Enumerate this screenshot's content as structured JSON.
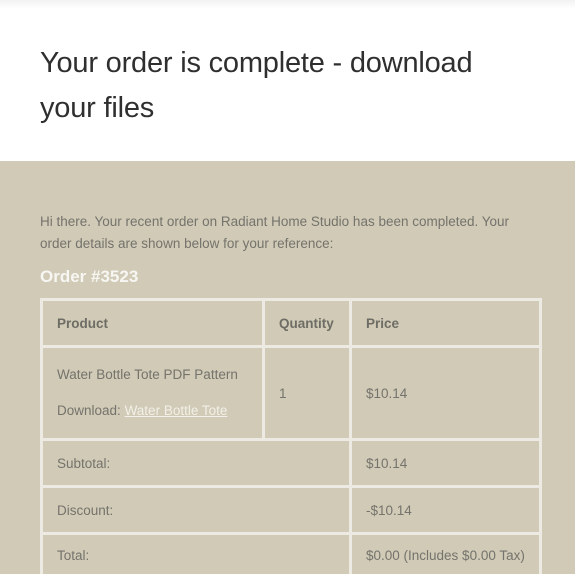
{
  "page": {
    "title": "Your order is complete - download your files",
    "intro": "Hi there. Your recent order on Radiant Home Studio has been completed. Your order details are shown below for your reference:",
    "order_heading": "Order #3523"
  },
  "colors": {
    "page_background": "#ffffff",
    "content_background": "#d0cab6",
    "table_border": "#eceae2",
    "body_text": "#74736c",
    "heading_text": "#2f2f2f",
    "order_heading_text": "#f7f6f2",
    "link_text": "#f2f0e8"
  },
  "table": {
    "headers": {
      "product": "Product",
      "quantity": "Quantity",
      "price": "Price"
    },
    "items": [
      {
        "name": "Water Bottle Tote PDF Pattern",
        "download_label": "Download:",
        "download_link_text": "Water Bottle Tote",
        "quantity": "1",
        "price": "$10.14"
      }
    ],
    "summary": [
      {
        "label": "Subtotal:",
        "value": "$10.14"
      },
      {
        "label": "Discount:",
        "value": "-$10.14"
      },
      {
        "label": "Total:",
        "value": "$0.00 (Includes $0.00 Tax)"
      }
    ]
  }
}
